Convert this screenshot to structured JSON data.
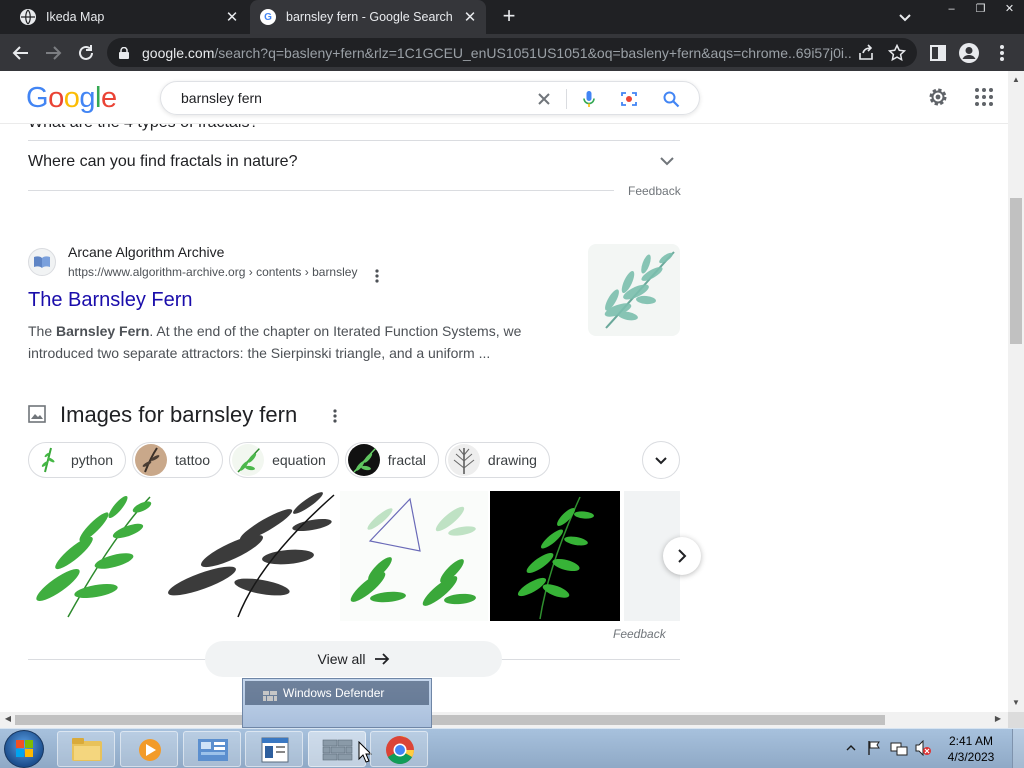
{
  "browser": {
    "tabs": [
      {
        "title": "Ikeda Map",
        "active": false,
        "close_label": "✕"
      },
      {
        "title": "barnsley fern - Google Search",
        "active": true,
        "close_label": "✕"
      }
    ],
    "new_tab_label": "+",
    "window_controls": [
      "–",
      "❐",
      "✕"
    ],
    "url_host": "google.com",
    "url_rest": "/search?q=basleny+fern&rlz=1C1GCEU_enUS1051US1051&oq=basleny+fern&aqs=chrome..69i57j0i..."
  },
  "google": {
    "logo_letters": [
      {
        "ch": "G",
        "color": "#4285F4"
      },
      {
        "ch": "o",
        "color": "#EA4335"
      },
      {
        "ch": "o",
        "color": "#FBBC05"
      },
      {
        "ch": "g",
        "color": "#4285F4"
      },
      {
        "ch": "l",
        "color": "#34A853"
      },
      {
        "ch": "e",
        "color": "#EA4335"
      }
    ],
    "query": "barnsley fern"
  },
  "faq": {
    "cut_question": "What are the 4 types of fractals?",
    "question": "Where can you find fractals in nature?",
    "feedback_label": "Feedback"
  },
  "result": {
    "site_name": "Arcane Algorithm Archive",
    "cite": "https://www.algorithm-archive.org › contents › barnsley",
    "title": "The Barnsley Fern",
    "snippet_prefix": "The ",
    "snippet_bold": "Barnsley Fern",
    "snippet_rest": ". At the end of the chapter on Iterated Function Systems, we introduced two separate attractors: the Sierpinski triangle, and a uniform ..."
  },
  "images": {
    "heading": "Images for barnsley fern",
    "chips": [
      "python",
      "tattoo",
      "equation",
      "fractal",
      "drawing"
    ],
    "feedback_label": "Feedback",
    "view_all_label": "View all"
  },
  "taskbar": {
    "popup_label": "Windows Defender",
    "time": "2:41 AM",
    "date": "4/3/2023"
  },
  "colors": {
    "link": "#1a0dab",
    "fern_green": "#3aa83a",
    "taskbar": "#9fb8d5"
  }
}
